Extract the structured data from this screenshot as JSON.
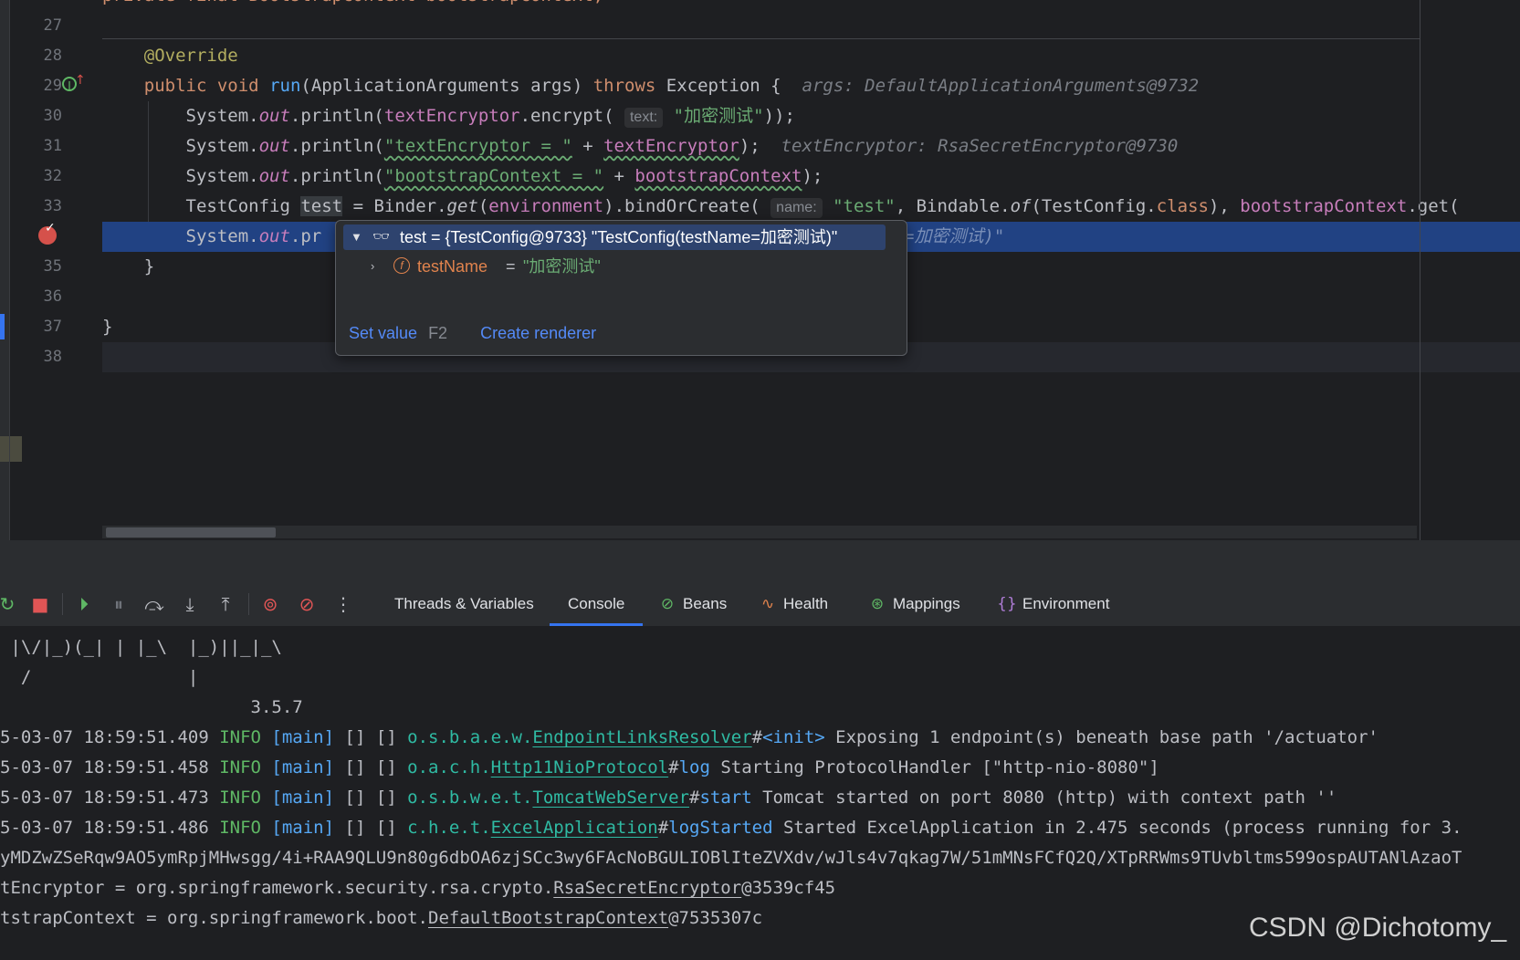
{
  "editor": {
    "top_partial": "private final BootstrapContext bootstrapContext;",
    "line_numbers": [
      "27",
      "28",
      "29",
      "30",
      "31",
      "32",
      "33",
      "",
      "35",
      "36",
      "37",
      "38"
    ],
    "lines": {
      "l28_annotation": "@Override",
      "l29_public": "public",
      "l29_void": "void",
      "l29_run": "run",
      "l29_sig": "(ApplicationArguments args) ",
      "l29_throws": "throws",
      "l29_exc": " Exception {  ",
      "l29_hint": "args: DefaultApplicationArguments@9732",
      "l30_a": "System.",
      "l30_out": "out",
      "l30_b": ".println(",
      "l30_field": "textEncryptor",
      "l30_c": ".encrypt( ",
      "l30_hint": "text:",
      "l30_str": "\"加密测试\"",
      "l30_d": "));",
      "l31_a": "System.",
      "l31_out": "out",
      "l31_b": ".println(",
      "l31_str": "\"textEncryptor = \"",
      "l31_plus": " + ",
      "l31_field": "textEncryptor",
      "l31_c": ");  ",
      "l31_hint": "textEncryptor: RsaSecretEncryptor@9730",
      "l32_a": "System.",
      "l32_out": "out",
      "l32_b": ".println(",
      "l32_str": "\"bootstrapContext = \"",
      "l32_plus": " + ",
      "l32_field": "bootstrapContext",
      "l32_c": ");",
      "l33_a": "TestConfig ",
      "l33_var": "test",
      "l33_b": " = Binder.",
      "l33_get": "get",
      "l33_c": "(",
      "l33_env": "environment",
      "l33_d": ").bindOrCreate( ",
      "l33_hint": "name:",
      "l33_str": "\"test\"",
      "l33_e": ", Bindable.",
      "l33_of": "of",
      "l33_f": "(TestConfig.",
      "l33_class": "class",
      "l33_g": "), ",
      "l33_field": "bootstrapContext",
      "l33_h": ".get(",
      "l34_a": "System.",
      "l34_out": "out",
      "l34_b": ".pr",
      "l34_tail": "=加密测试)\"",
      "l35_brace": "}",
      "l37_brace": "}"
    }
  },
  "popup": {
    "row1_text": "test = {TestConfig@9733} \"TestConfig(testName=加密测试)\"",
    "field_icon": "f",
    "row2_name": "testName",
    "row2_eq": "=",
    "row2_value": "\"加密测试\"",
    "set_value_label": "Set value",
    "set_value_key": "F2",
    "create_renderer_label": "Create renderer"
  },
  "toolbar": {
    "tabs": [
      {
        "label": "Threads & Variables",
        "icon": ""
      },
      {
        "label": "Console",
        "icon": ""
      },
      {
        "label": "Beans",
        "icon": "beans-icon"
      },
      {
        "label": "Health",
        "icon": "health-icon"
      },
      {
        "label": "Mappings",
        "icon": "mappings-icon"
      },
      {
        "label": "Environment",
        "icon": "environment-icon"
      }
    ],
    "active_tab": "Console",
    "accent_color": "#3574f0"
  },
  "console": {
    "banner1": " |\\/|_)(_| | |_\\  |_)||_|_\\",
    "banner2": "  /               |",
    "banner3": "                        3.5.7",
    "logs": [
      {
        "ts": "5-03-07 18:59:51.409 ",
        "level": "INFO",
        "thread": " [main]",
        "ctx": " [] [] ",
        "pkg": "o.s.b.a.e.w.",
        "cls": "EndpointLinksResolver",
        "hash": "#",
        "method": "<init>",
        "msg": " Exposing 1 endpoint(s) beneath base path '/actuator'"
      },
      {
        "ts": "5-03-07 18:59:51.458 ",
        "level": "INFO",
        "thread": " [main]",
        "ctx": " [] [] ",
        "pkg": "o.a.c.h.",
        "cls": "Http11NioProtocol",
        "hash": "#",
        "method": "log",
        "msg": " Starting ProtocolHandler [\"http-nio-8080\"]"
      },
      {
        "ts": "5-03-07 18:59:51.473 ",
        "level": "INFO",
        "thread": " [main]",
        "ctx": " [] [] ",
        "pkg": "o.s.b.w.e.t.",
        "cls": "TomcatWebServer",
        "hash": "#",
        "method": "start",
        "msg": " Tomcat started on port 8080 (http) with context path ''"
      },
      {
        "ts": "5-03-07 18:59:51.486 ",
        "level": "INFO",
        "thread": " [main]",
        "ctx": " [] [] ",
        "pkg": "c.h.e.t.",
        "cls": "ExcelApplication",
        "hash": "#",
        "method": "logStarted",
        "msg": " Started ExcelApplication in 2.475 seconds (process running for 3."
      }
    ],
    "cipher": "yMDZwZSeRqw9AO5ymRpjMHwsgg/4i+RAA9QLU9n80g6dbOA6zjSCc3wy6FAcNoBGULIOBlIteZVXdv/wJls4v7qkag7W/51mMNsFCfQ2Q/XTpRRWms9TUvbltms599ospAUTANlAzaoT",
    "enc_prefix": "tEncryptor = org.springframework.security.rsa.crypto.",
    "enc_link": "RsaSecretEncryptor",
    "enc_suffix": "@3539cf45",
    "ctx_prefix": "tstrapContext = org.springframework.boot.",
    "ctx_link": "DefaultBootstrapContext",
    "ctx_suffix": "@7535307c"
  },
  "watermark": "CSDN @Dichotomy_"
}
